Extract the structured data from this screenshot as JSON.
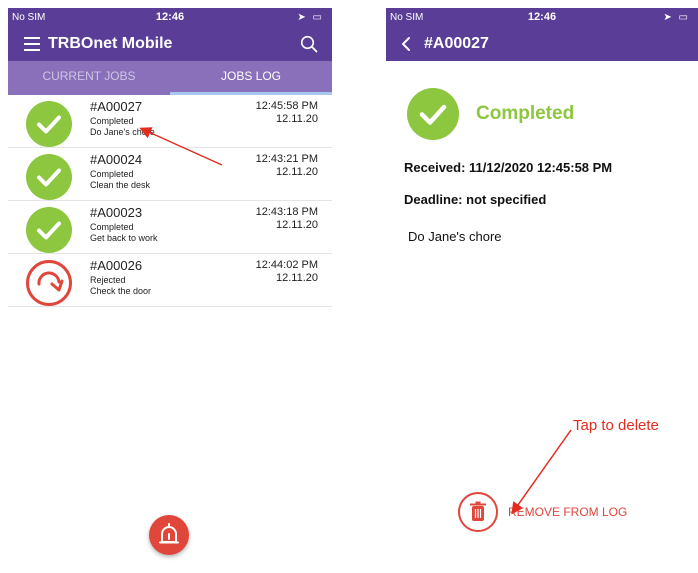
{
  "left_screen": {
    "status_bar": {
      "carrier": "No SIM",
      "time": "12:46"
    },
    "app_title": "TRBOnet Mobile",
    "tabs": [
      {
        "label": "CURRENT JOBS",
        "active": false
      },
      {
        "label": "JOBS LOG",
        "active": true
      }
    ],
    "jobs": [
      {
        "id": "#A00027",
        "status": "Completed",
        "description": "Do Jane's chore",
        "time": "12:45:58 PM",
        "date": "12.11.20",
        "icon": "check-icon"
      },
      {
        "id": "#A00024",
        "status": "Completed",
        "description": "Clean the desk",
        "time": "12:43:21 PM",
        "date": "12.11.20",
        "icon": "check-icon"
      },
      {
        "id": "#A00023",
        "status": "Completed",
        "description": "Get back to work",
        "time": "12:43:18 PM",
        "date": "12.11.20",
        "icon": "check-icon"
      },
      {
        "id": "#A00026",
        "status": "Rejected",
        "description": "Check the door",
        "time": "12:44:02 PM",
        "date": "12.11.20",
        "icon": "rejected-arrow-icon"
      }
    ],
    "fab_icon": "alarm-bell-icon"
  },
  "right_screen": {
    "status_bar": {
      "carrier": "No SIM",
      "time": "12:46"
    },
    "title": "#A00027",
    "status": "Completed",
    "received": "Received: 11/12/2020 12:45:58 PM",
    "deadline": "Deadline: not specified",
    "description": "Do Jane's chore",
    "remove_label": "REMOVE FROM LOG",
    "remove_icon": "trash-icon"
  },
  "annotation": {
    "text": "Tap to delete"
  },
  "colors": {
    "header": "#5a3d96",
    "tab_bar": "#8a70ba",
    "completed": "#8dc63f",
    "rejected": "#e0463a",
    "annotation": "#e32b20"
  }
}
